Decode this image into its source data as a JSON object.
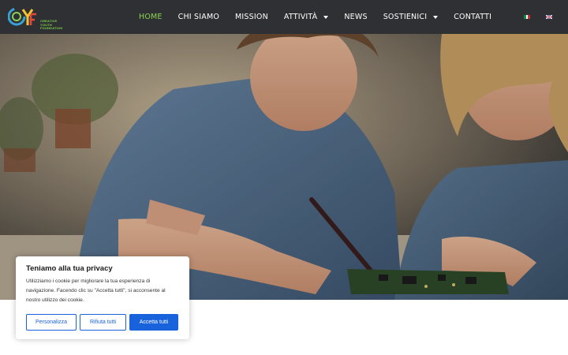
{
  "header": {
    "logo_icon": "cyf-logo-icon",
    "logo_text_line1": "CREATIVE YOUTH",
    "logo_text_line2": "FOUNDATION",
    "nav": [
      {
        "label": "HOME",
        "active": true
      },
      {
        "label": "CHI SIAMO"
      },
      {
        "label": "MISSION"
      },
      {
        "label": "ATTIVITÀ",
        "dropdown": true
      },
      {
        "label": "NEWS"
      },
      {
        "label": "SOSTIENICI",
        "dropdown": true
      },
      {
        "label": "CONTATTI"
      }
    ],
    "languages": [
      {
        "code": "it",
        "icon": "italian-flag-icon"
      },
      {
        "code": "en",
        "icon": "uk-flag-icon"
      }
    ],
    "accent_color": "#8bd252",
    "background_color": "#2f3033"
  },
  "hero": {
    "image": "two-students-soldering-circuit-board-photo"
  },
  "cookie_banner": {
    "title": "Teniamo alla tua privacy",
    "text": "Utilizziamo i cookie per migliorare la tua esperienza di navigazione. Facendo clic su \"Accetta tutti\", si acconsente al nostro utilizzo dei cookie.",
    "buttons": {
      "customize": "Personalizza",
      "reject": "Rifiuta tutti",
      "accept": "Accetta tutti"
    },
    "button_color": "#1863dc"
  }
}
